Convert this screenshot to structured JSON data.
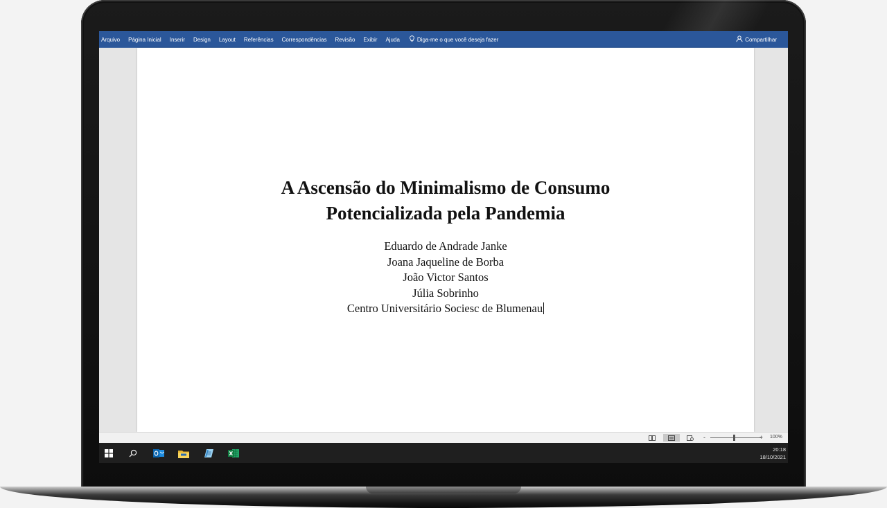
{
  "ribbon": {
    "tabs": [
      "Arquivo",
      "Página Inicial",
      "Inserir",
      "Design",
      "Layout",
      "Referências",
      "Correspondências",
      "Revisão",
      "Exibir",
      "Ajuda"
    ],
    "tell_me": "Diga-me o que você deseja fazer",
    "share": "Compartilhar",
    "color": "#2b579a"
  },
  "document": {
    "title_line_1": "A Ascensão do Minimalismo de Consumo",
    "title_line_2": "Potencializada pela Pandemia",
    "authors": [
      "Eduardo de Andrade Janke",
      "Joana Jaqueline de Borba",
      "João Victor Santos",
      "Júlia Sobrinho"
    ],
    "institution": "Centro Universitário Sociesc de Blumenau"
  },
  "status_bar": {
    "zoom_minus": "-",
    "zoom_plus": "+",
    "zoom_level": "100%",
    "view_modes": [
      "read-mode-icon",
      "print-layout-icon",
      "web-layout-icon"
    ],
    "active_view": "print-layout-icon"
  },
  "taskbar": {
    "icons": [
      "windows-start-icon",
      "search-icon",
      "outlook-icon",
      "file-explorer-icon",
      "notepad-icon",
      "excel-icon"
    ],
    "time": "20:18",
    "date": "18/10/2021"
  }
}
